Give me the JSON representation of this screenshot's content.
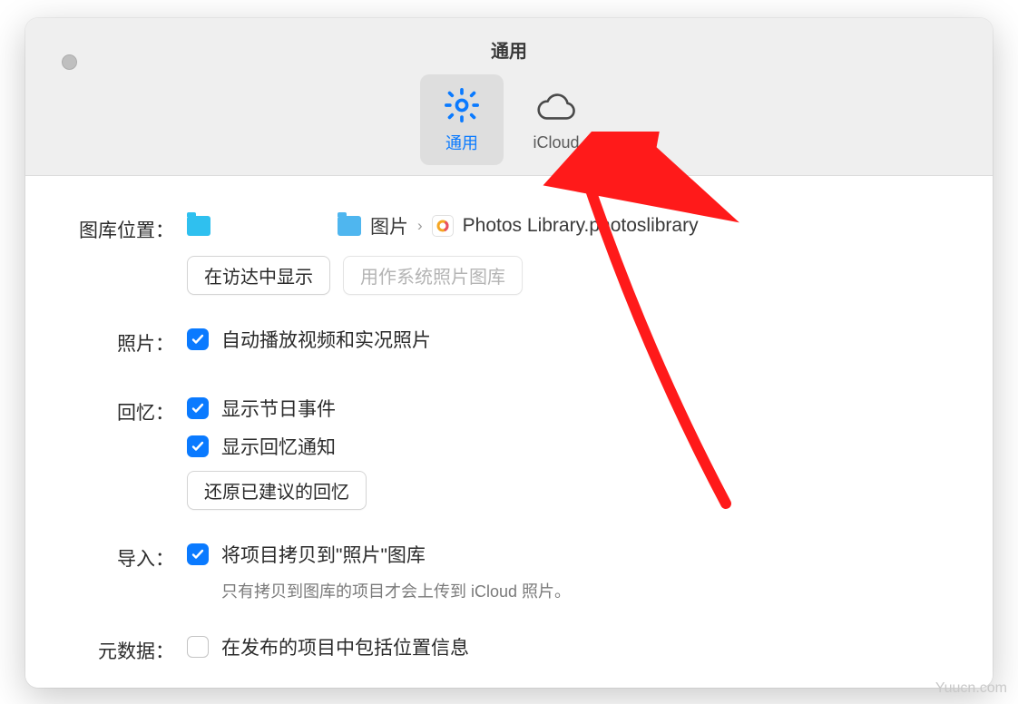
{
  "window": {
    "title": "通用"
  },
  "tabs": {
    "general": "通用",
    "icloud": "iCloud"
  },
  "library": {
    "label": "图库位置：",
    "folder_pictures": "图片",
    "library_name": "Photos Library.photoslibrary",
    "show_in_finder": "在访达中显示",
    "use_as_system": "用作系统照片图库"
  },
  "photos": {
    "label": "照片：",
    "autoplay": "自动播放视频和实况照片"
  },
  "memories": {
    "label": "回忆：",
    "show_holidays": "显示节日事件",
    "show_notifications": "显示回忆通知",
    "reset_suggested": "还原已建议的回忆"
  },
  "import": {
    "label": "导入：",
    "copy_items": "将项目拷贝到\"照片\"图库",
    "helper": "只有拷贝到图库的项目才会上传到 iCloud 照片。"
  },
  "metadata": {
    "label": "元数据：",
    "include_location": "在发布的项目中包括位置信息"
  },
  "watermark": "Yuucn.com"
}
